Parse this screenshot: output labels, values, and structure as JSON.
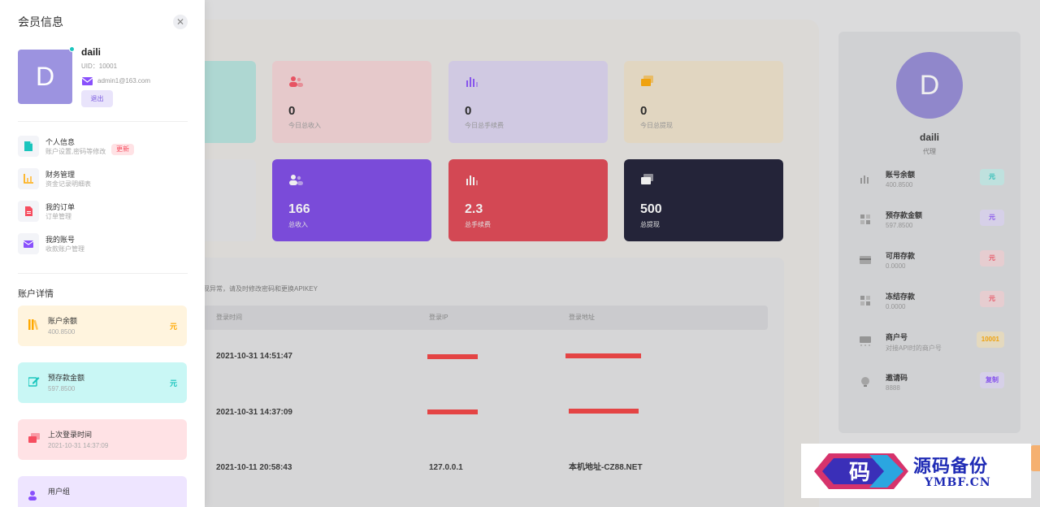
{
  "drawer": {
    "title": "会员信息",
    "close_glyph": "✕",
    "avatar_letter": "D",
    "username": "daili",
    "uid": "UID：10001",
    "email": "admin1@163.com",
    "logout_label": "退出",
    "menu": [
      {
        "title": "个人信息",
        "subtitle": "账户设置,密码等修改",
        "badge": "更新",
        "icon": "user-doc-icon",
        "color": "#1bc5bd"
      },
      {
        "title": "财务管理",
        "subtitle": "资金记录明细表",
        "icon": "chart-icon",
        "color": "#ffa800"
      },
      {
        "title": "我的订单",
        "subtitle": "订单管理",
        "icon": "file-icon",
        "color": "#f64e60"
      },
      {
        "title": "我的账号",
        "subtitle": "收款账户管理",
        "icon": "mail-icon",
        "color": "#8950fc"
      }
    ],
    "section_title": "账户详情",
    "account_cards": [
      {
        "title": "账户余额",
        "value": "400.8500",
        "unit": "元",
        "bg": "#fff4de",
        "accent": "#ffa800",
        "icon": "books-icon"
      },
      {
        "title": "预存款金额",
        "value": "597.8500",
        "unit": "元",
        "bg": "#c9f7f5",
        "accent": "#1bc5bd",
        "icon": "edit-icon"
      },
      {
        "title": "上次登录时间",
        "value": "2021-10-31 14:37:09",
        "unit": "",
        "bg": "#ffe2e5",
        "accent": "#f64e60",
        "icon": "monitor-icon"
      },
      {
        "title": "用户组",
        "value": "",
        "unit": "",
        "bg": "#eee5ff",
        "accent": "#8950fc",
        "icon": "group-icon"
      }
    ]
  },
  "stats_top": [
    {
      "value": "0",
      "label": "今日总收入",
      "bg": "#f5d4d7",
      "icon_color": "#f64e60"
    },
    {
      "value": "0",
      "label": "今日总手续费",
      "bg": "#dcd4f1",
      "icon_color": "#8950fc"
    },
    {
      "value": "0",
      "label": "今日总提现",
      "bg": "#f0e3cb",
      "icon_color": "#ffa800"
    }
  ],
  "stats_bottom": [
    {
      "value": "166",
      "label": "总收入",
      "bg": "#7a45e6"
    },
    {
      "value": "2.3",
      "label": "总手续费",
      "bg": "#e0414f"
    },
    {
      "value": "500",
      "label": "总提现",
      "bg": "#181930"
    }
  ],
  "login": {
    "note": "现异常，请及时修改密码和更换APIKEY",
    "headers": [
      "登录时间",
      "登录IP",
      "登录地址"
    ],
    "rows": [
      {
        "time": "2021-10-31 14:51:47",
        "ip": "",
        "addr": ""
      },
      {
        "time": "2021-10-31 14:37:09",
        "ip": "",
        "addr": ""
      },
      {
        "time": "2021-10-11 20:58:43",
        "ip": "127.0.0.1",
        "addr": "本机地址-CZ88.NET"
      }
    ]
  },
  "profile": {
    "avatar_letter": "D",
    "name": "daili",
    "role": "代理",
    "items": [
      {
        "title": "账号余额",
        "value": "400.8500",
        "badge": "元",
        "badge_bg": "#c9f0ec",
        "badge_fg": "#1bc5bd",
        "icon": "bar-chart-icon"
      },
      {
        "title": "预存款金额",
        "value": "597.8500",
        "badge": "元",
        "badge_bg": "#e3dcf8",
        "badge_fg": "#8950fc",
        "icon": "grid-icon"
      },
      {
        "title": "可用存款",
        "value": "0.0000",
        "badge": "元",
        "badge_bg": "#f5d9dc",
        "badge_fg": "#f64e60",
        "icon": "card-icon"
      },
      {
        "title": "冻结存款",
        "value": "0.0000",
        "badge": "元",
        "badge_bg": "#f5d9dc",
        "badge_fg": "#f64e60",
        "icon": "grid-icon"
      },
      {
        "title": "商户号",
        "value": "对接API时的商户号",
        "badge": "10001",
        "badge_bg": "#f3e6c8",
        "badge_fg": "#ffa800",
        "icon": "terminal-icon"
      },
      {
        "title": "邀请码",
        "value": "8888",
        "badge": "复制",
        "badge_bg": "#e3dcf8",
        "badge_fg": "#8950fc",
        "icon": "globe-icon"
      }
    ]
  },
  "watermark": {
    "text": "源码备份",
    "sub": "YMBF.CN",
    "logo_char": "码"
  }
}
